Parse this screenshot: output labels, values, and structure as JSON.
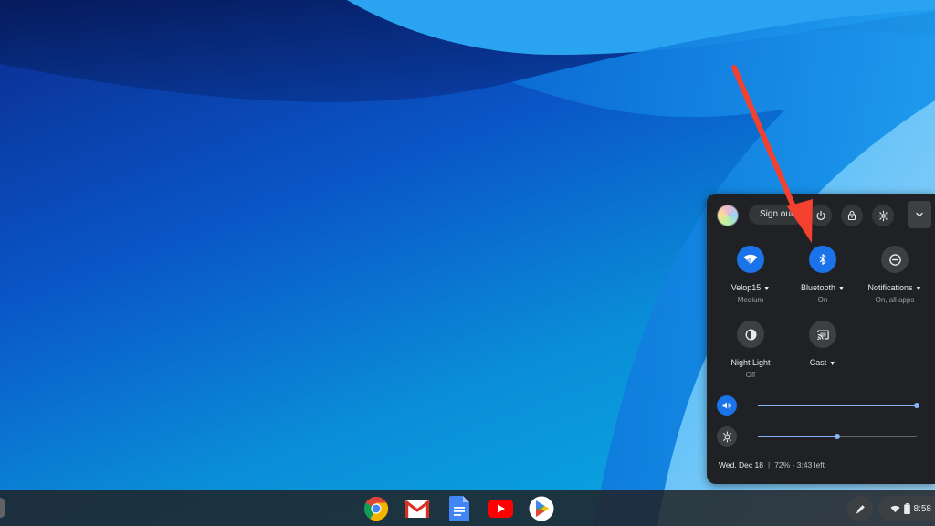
{
  "quick_settings": {
    "sign_out_label": "Sign out",
    "tiles": [
      {
        "label": "Velop15",
        "sub": "Medium",
        "icon": "wifi-icon",
        "active": true,
        "has_menu": true
      },
      {
        "label": "Bluetooth",
        "sub": "On",
        "icon": "bluetooth-icon",
        "active": true,
        "has_menu": true
      },
      {
        "label": "Notifications",
        "sub": "On, all apps",
        "icon": "notifications-icon",
        "active": false,
        "has_menu": true
      },
      {
        "label": "Night Light",
        "sub": "Off",
        "icon": "night-light-icon",
        "active": false,
        "has_menu": false
      },
      {
        "label": "Cast",
        "sub": "",
        "icon": "cast-icon",
        "active": false,
        "has_menu": true
      }
    ],
    "volume_level": 1.0,
    "brightness_level": 0.5,
    "date": "Wed, Dec 18",
    "battery": "72% - 3:43 left"
  },
  "shelf": {
    "apps": [
      {
        "name": "Chrome",
        "icon": "chrome-icon"
      },
      {
        "name": "Gmail",
        "icon": "gmail-icon"
      },
      {
        "name": "Docs",
        "icon": "docs-icon"
      },
      {
        "name": "YouTube",
        "icon": "youtube-icon"
      },
      {
        "name": "Play Store",
        "icon": "play-store-icon"
      }
    ],
    "time": "8:58"
  },
  "colors": {
    "accent": "#1a73e8",
    "panel_bg": "#202124",
    "annotation_arrow": "#f4412f"
  }
}
